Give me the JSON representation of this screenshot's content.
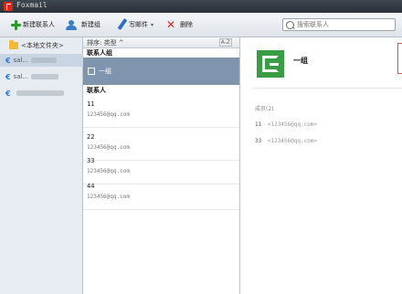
{
  "window": {
    "title": "Foxmail"
  },
  "toolbar": {
    "new_contact": "新建联系人",
    "new_group": "新建组",
    "write_mail": "写邮件",
    "delete": "删除",
    "search_placeholder": "搜索联系人"
  },
  "folders": {
    "local": "<本地文件夹>",
    "accounts": [
      {
        "label": "sal..."
      },
      {
        "label": "sal..."
      },
      {
        "label": ""
      }
    ]
  },
  "list": {
    "sort_label": "排序: 类型 ^",
    "az_label": "A-Z",
    "groups_header": "联系人组",
    "group_name": "一组",
    "contacts_header": "联系人",
    "contacts": [
      {
        "name": "11",
        "email": "123456@qq.com"
      },
      {
        "name": "22",
        "email": "123456@qq.com"
      },
      {
        "name": "33",
        "email": "123456@qq.com"
      },
      {
        "name": "44",
        "email": "123456@qq.com"
      }
    ]
  },
  "detail": {
    "group_name": "一组",
    "members_label": "成员(2)",
    "members": [
      {
        "name": "11",
        "email": "<123456@qq.com>"
      },
      {
        "name": "33",
        "email": "<123456@qq.com>"
      }
    ]
  },
  "colors": {
    "accent": "#3a9d46",
    "selection": "#7f95ad",
    "delete_icon": "#d8261c"
  }
}
